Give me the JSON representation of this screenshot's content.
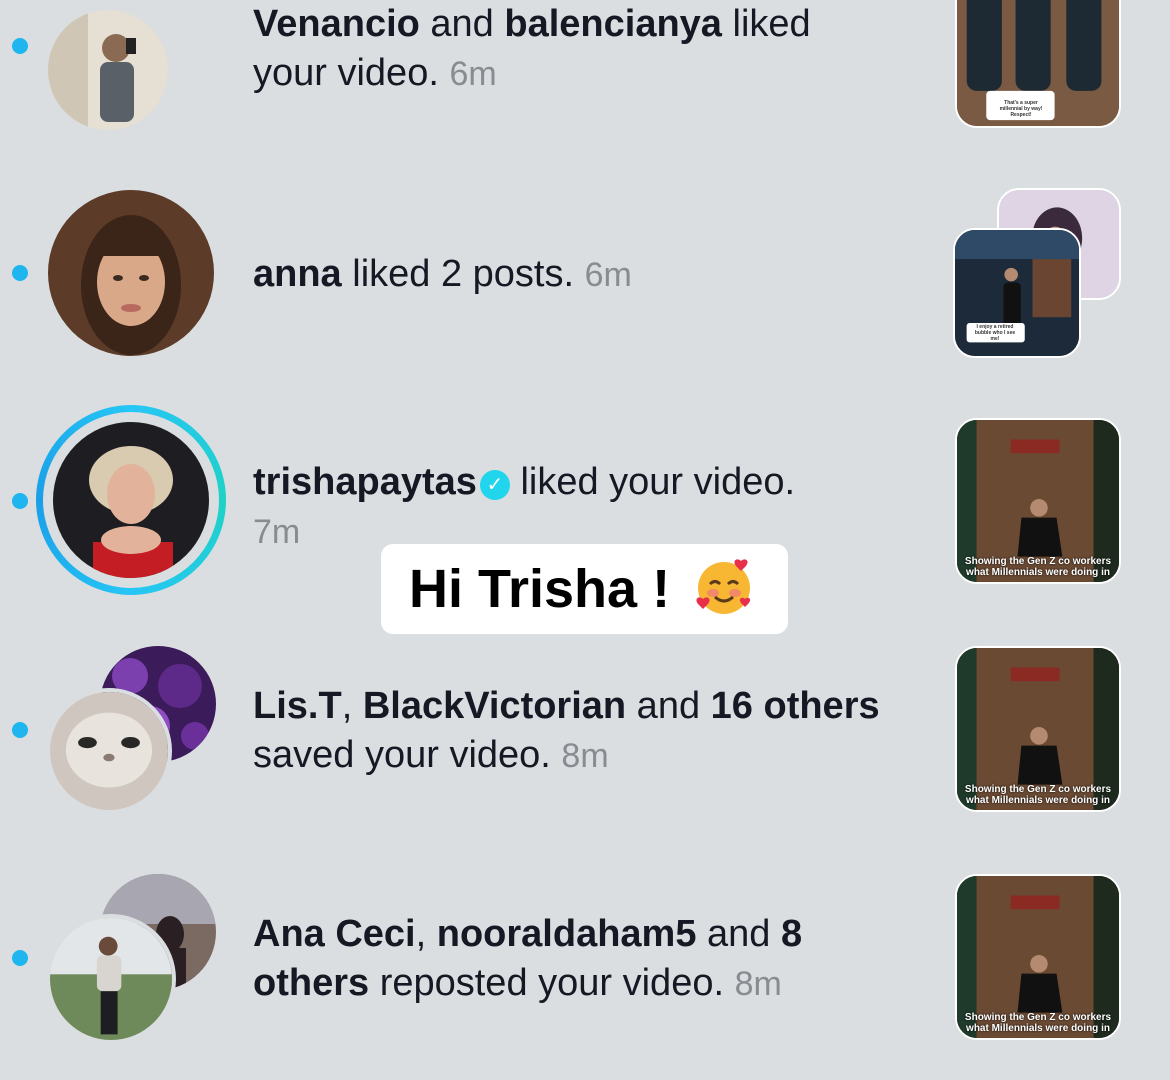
{
  "notifications": [
    {
      "actor1": "Venancio",
      "joiner1": " and ",
      "actor2": "balencianya",
      "action": " liked your video.",
      "time": "6m",
      "thumb_caption": "That's a super millennial by way! Respect!"
    },
    {
      "actor1": "anna",
      "action": " liked 2 posts.",
      "time": "6m",
      "thumb_caption": "I enjoy a retired bubble who I see me!"
    },
    {
      "actor1": "trishapaytas",
      "action": " liked your video.",
      "time": "7m",
      "thumb_caption": "Showing the Gen Z co workers what Millennials were doing in"
    },
    {
      "actor1": "Lis.T",
      "joiner1": ", ",
      "actor2": "BlackVictorian",
      "joiner2": " and ",
      "actor3": "16 others",
      "action": " saved your video.",
      "time": "8m",
      "thumb_caption": "Showing the Gen Z co workers what Millennials were doing in"
    },
    {
      "actor1": "Ana Ceci",
      "joiner1": ", ",
      "actor2": "nooraldaham5",
      "joiner2": " and ",
      "actor3": "8 others",
      "action": " reposted your video.",
      "time": "8m",
      "thumb_caption": "Showing the Gen Z co workers what Millennials were doing in"
    }
  ],
  "sticker": {
    "text": "Hi Trisha !",
    "emoji": "smiling-face-with-hearts"
  },
  "colors": {
    "unread_dot": "#1fb6f0",
    "verified": "#20d5ec",
    "background": "#dadee1"
  }
}
